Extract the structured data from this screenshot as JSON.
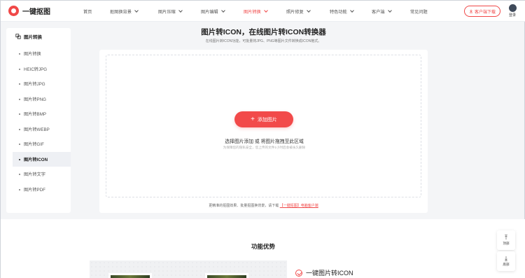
{
  "brand": {
    "name": "一键抠图"
  },
  "nav": {
    "items": [
      {
        "label": "首页",
        "has_menu": false
      },
      {
        "label": "抠图换背景",
        "has_menu": true
      },
      {
        "label": "图片压缩",
        "has_menu": true
      },
      {
        "label": "图片编辑",
        "has_menu": true
      },
      {
        "label": "图片转换",
        "has_menu": true
      },
      {
        "label": "照片修复",
        "has_menu": true
      },
      {
        "label": "特色功能",
        "has_menu": true
      },
      {
        "label": "客户端",
        "has_menu": true
      },
      {
        "label": "常见问题",
        "has_menu": false
      }
    ],
    "active_label": "图片转换"
  },
  "header": {
    "download_label": "客户端下载",
    "login_label": "登录"
  },
  "sidebar": {
    "title": "图片转换",
    "items": [
      {
        "label": "图片转换"
      },
      {
        "label": "HEIC转JPG"
      },
      {
        "label": "图片转JPG"
      },
      {
        "label": "图片转PNG"
      },
      {
        "label": "图片转BMP"
      },
      {
        "label": "图片转WEBP"
      },
      {
        "label": "图片转GIF"
      },
      {
        "label": "图片转ICON"
      },
      {
        "label": "图片转文字"
      },
      {
        "label": "图片转PDF"
      }
    ],
    "active_label": "图片转ICON"
  },
  "main": {
    "title": "图片转ICON，在线图片转ICON转换器",
    "subtitle": "在线图片转ICON功能，可批量将JPG、PNG等图片文件转换成ICON格式。",
    "add_button_label": "添加图片",
    "drop_hint": "选择图片添加 或 将图片拖拽至此区域",
    "drop_note": "为保障您的隐私安全，您上传的文件1小时后会被永久删除",
    "footer_text": "更精准的抠图效果、批量抠图换背景，请下载",
    "footer_link": "【一键抠图】电脑客户端"
  },
  "features": {
    "section_title": "功能优势",
    "first_feature": "一键图片转ICON"
  },
  "float": {
    "top_label": "顶部",
    "bottom_label": "底部"
  },
  "colors": {
    "accent": "#f04848",
    "background": "#f4f5f7"
  }
}
